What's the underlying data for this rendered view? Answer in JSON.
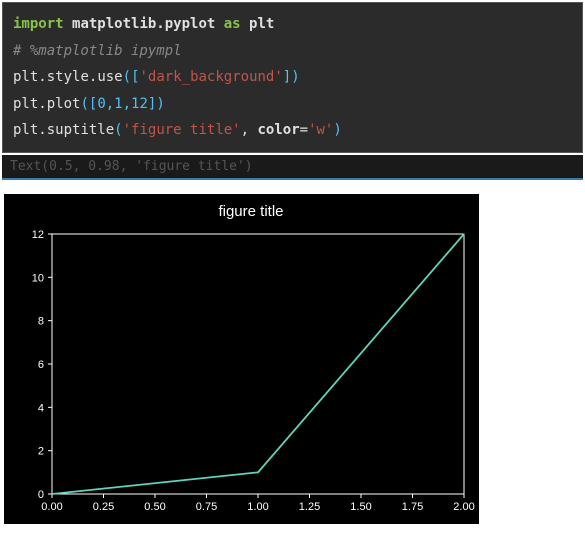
{
  "code": {
    "line1": {
      "import": "import",
      "mod1": "matplotlib.pyplot",
      "as": "as",
      "alias": "plt"
    },
    "line2": "# %matplotlib ipympl",
    "line3": {
      "obj": "plt",
      "method": "style",
      "method2": "use",
      "arg": "'dark_background'"
    },
    "line4": {
      "obj": "plt",
      "method": "plot",
      "nums": "[0,1,12]"
    },
    "line5": {
      "obj": "plt",
      "method": "suptitle",
      "str": "'figure title'",
      "kwarg": "color",
      "val": "'w'"
    }
  },
  "output": "Text(0.5, 0.98, 'figure title')",
  "chart_data": {
    "type": "line",
    "title": "figure title",
    "xlabel": "",
    "ylabel": "",
    "x": [
      0,
      1,
      2
    ],
    "y": [
      0,
      1,
      12
    ],
    "xlim": [
      0.0,
      2.0
    ],
    "ylim": [
      0,
      12
    ],
    "xticks": [
      0.0,
      0.25,
      0.5,
      0.75,
      1.0,
      1.25,
      1.5,
      1.75,
      2.0
    ],
    "yticks": [
      0,
      2,
      4,
      6,
      8,
      10,
      12
    ]
  }
}
